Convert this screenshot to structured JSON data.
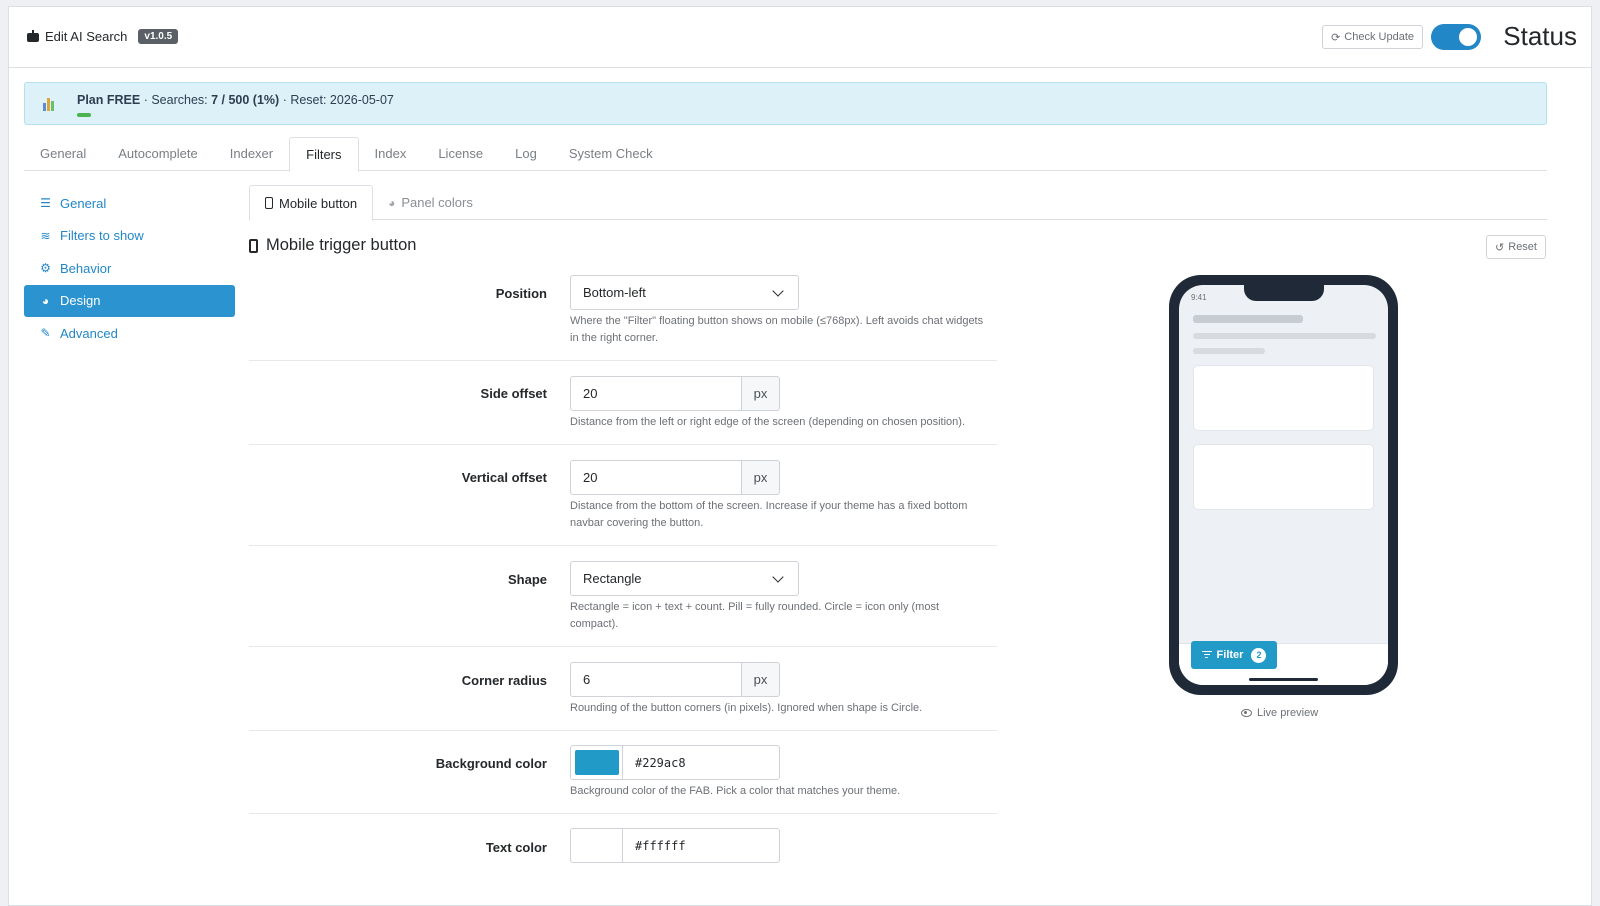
{
  "header": {
    "title": "Edit AI Search",
    "version": "v1.0.5",
    "check_update": "Check Update",
    "status_label": "Status",
    "status_on": true
  },
  "plan": {
    "prefix": "Plan FREE",
    "searches_label": "· Searches:",
    "searches_value": "7 / 500 (1%)",
    "reset_text": "· Reset: 2026-05-07",
    "usage_percent": 1
  },
  "tabs": [
    {
      "label": "General"
    },
    {
      "label": "Autocomplete"
    },
    {
      "label": "Indexer"
    },
    {
      "label": "Filters",
      "active": true
    },
    {
      "label": "Index"
    },
    {
      "label": "License"
    },
    {
      "label": "Log"
    },
    {
      "label": "System Check"
    }
  ],
  "sidebar": {
    "items": [
      {
        "label": "General",
        "icon": "sliders-icon"
      },
      {
        "label": "Filters to show",
        "icon": "layers-icon"
      },
      {
        "label": "Behavior",
        "icon": "gear-icon"
      },
      {
        "label": "Design",
        "icon": "palette-icon",
        "active": true
      },
      {
        "label": "Advanced",
        "icon": "wrench-icon"
      }
    ]
  },
  "subtabs": [
    {
      "label": "Mobile button",
      "icon": "mobile-icon",
      "active": true
    },
    {
      "label": "Panel colors",
      "icon": "palette-icon"
    }
  ],
  "section": {
    "title": "Mobile trigger button",
    "reset": "Reset"
  },
  "form": {
    "position": {
      "label": "Position",
      "value": "Bottom-left",
      "help": "Where the \"Filter\" floating button shows on mobile (≤768px). Left avoids chat widgets in the right corner."
    },
    "side_offset": {
      "label": "Side offset",
      "value": "20",
      "unit": "px",
      "help": "Distance from the left or right edge of the screen (depending on chosen position)."
    },
    "vertical_offset": {
      "label": "Vertical offset",
      "value": "20",
      "unit": "px",
      "help": "Distance from the bottom of the screen. Increase if your theme has a fixed bottom navbar covering the button."
    },
    "shape": {
      "label": "Shape",
      "value": "Rectangle",
      "help": "Rectangle = icon + text + count. Pill = fully rounded. Circle = icon only (most compact)."
    },
    "corner_radius": {
      "label": "Corner radius",
      "value": "6",
      "unit": "px",
      "help": "Rounding of the button corners (in pixels). Ignored when shape is Circle."
    },
    "background_color": {
      "label": "Background color",
      "value": "#229ac8",
      "help": "Background color of the FAB. Pick a color that matches your theme."
    },
    "text_color": {
      "label": "Text color",
      "value": "#ffffff"
    }
  },
  "preview": {
    "time": "9:41",
    "fab_label": "Filter",
    "fab_count": "2",
    "caption": "Live preview"
  },
  "colors": {
    "accent": "#2287c7",
    "sidebar_active": "#2a93d0",
    "fab": "#229ac8",
    "plan_bg": "#dcf1f8",
    "usage_bar": "#4bb34f"
  }
}
